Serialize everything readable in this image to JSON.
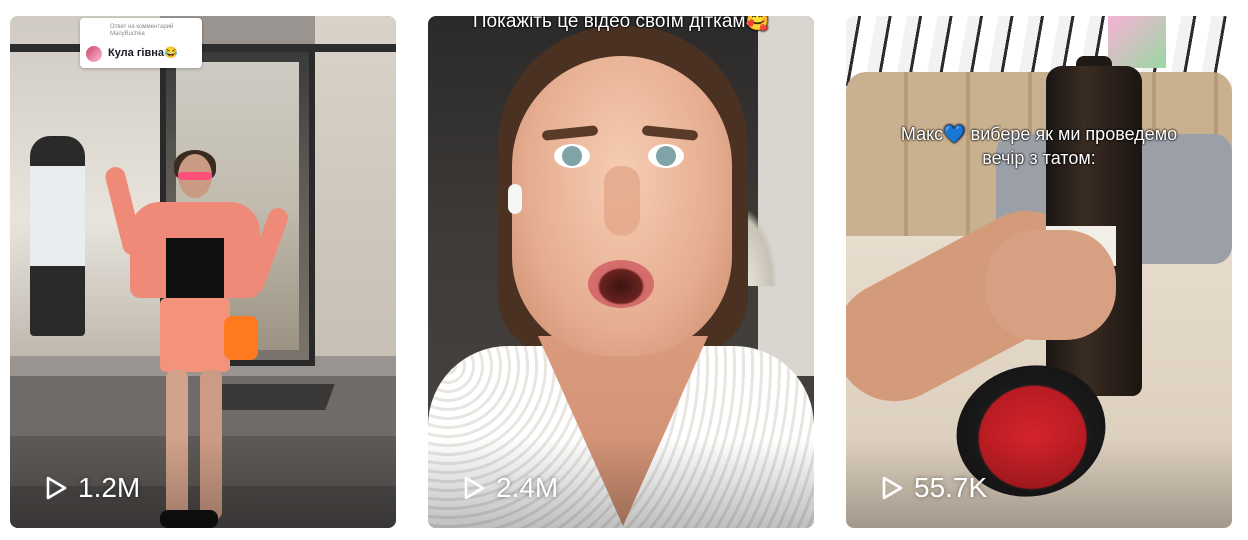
{
  "videos": [
    {
      "views": "1.2M",
      "play_icon": "play-icon",
      "reply_meta": "Ответ на комментарий\nManyBuchka",
      "reply_text": "Кула гівна😂"
    },
    {
      "views": "2.4M",
      "play_icon": "play-icon",
      "caption": "Покажіть це відео своїм діткам🥰"
    },
    {
      "views": "55.7K",
      "play_icon": "play-icon",
      "caption_name": "Макс",
      "caption_heart": "💙",
      "caption_rest": "вибере як ми проведемо вечір з татом:"
    }
  ],
  "colors": {
    "overlay_text": "#ffffff",
    "heart_blue": "#3a8ef0",
    "comment_bg": "#ffffff"
  }
}
